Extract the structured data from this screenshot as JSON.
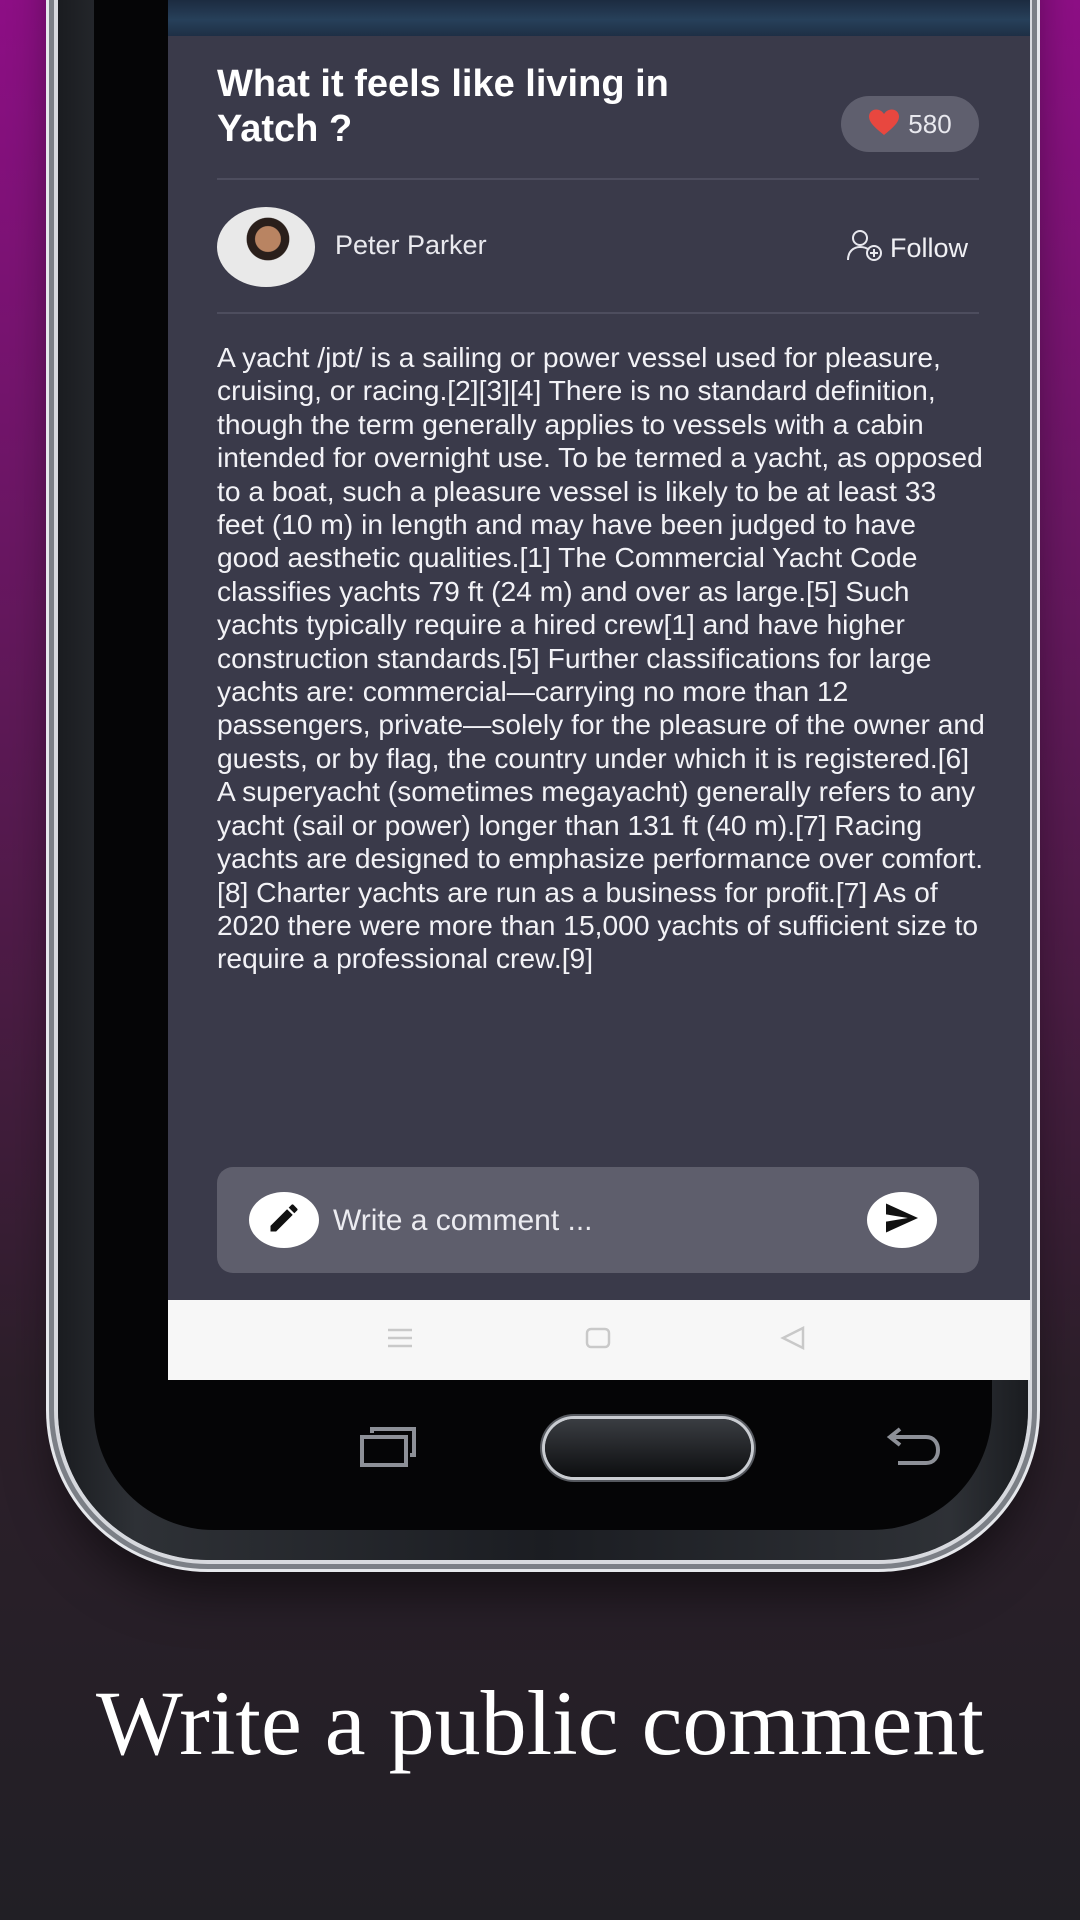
{
  "post": {
    "title": "What it feels like living in Yatch ?",
    "likes": "580",
    "author": "Peter Parker",
    "follow_label": "Follow",
    "body": "A yacht /jɒt/ is a sailing or power vessel used for pleasure, cruising, or racing.[2][3][4] There is no standard definition, though the term generally applies to vessels with a cabin intended for overnight use. To be termed a yacht, as opposed to a boat, such a pleasure vessel is likely to be at least 33 feet (10 m) in length and may have been judged to have good aesthetic qualities.[1] The Commercial Yacht Code classifies yachts 79 ft (24 m) and over as large.[5] Such yachts typically require a hired crew[1] and have higher construction standards.[5] Further classifications for large yachts are: commercial—carrying no more than 12 passengers, private—solely for the pleasure of the owner and guests, or by flag, the country under which it is registered.[6] A superyacht (sometimes megayacht) generally refers to any yacht (sail or power) longer than 131 ft (40 m).[7] Racing yachts are designed to emphasize performance over comfort.[8] Charter yachts are run as a business for profit.[7] As of 2020 there were more than 15,000 yachts of sufficient size to require a professional crew.[9]"
  },
  "comment": {
    "placeholder": "Write a comment ...",
    "value": ""
  },
  "icons": {
    "like": "heart-icon",
    "follow": "add-user-icon",
    "edit": "pencil-icon",
    "send": "send-icon",
    "nav_menu": "menu-icon",
    "nav_home": "square-icon",
    "nav_back": "triangle-back-icon"
  },
  "colors": {
    "card_background": "#3a3a4a",
    "comment_background": "#5e5e6c",
    "like_pill": "#5f5f6e",
    "heart": "#e8473f",
    "caption": "#ffffff"
  },
  "caption": "Write a public comment"
}
